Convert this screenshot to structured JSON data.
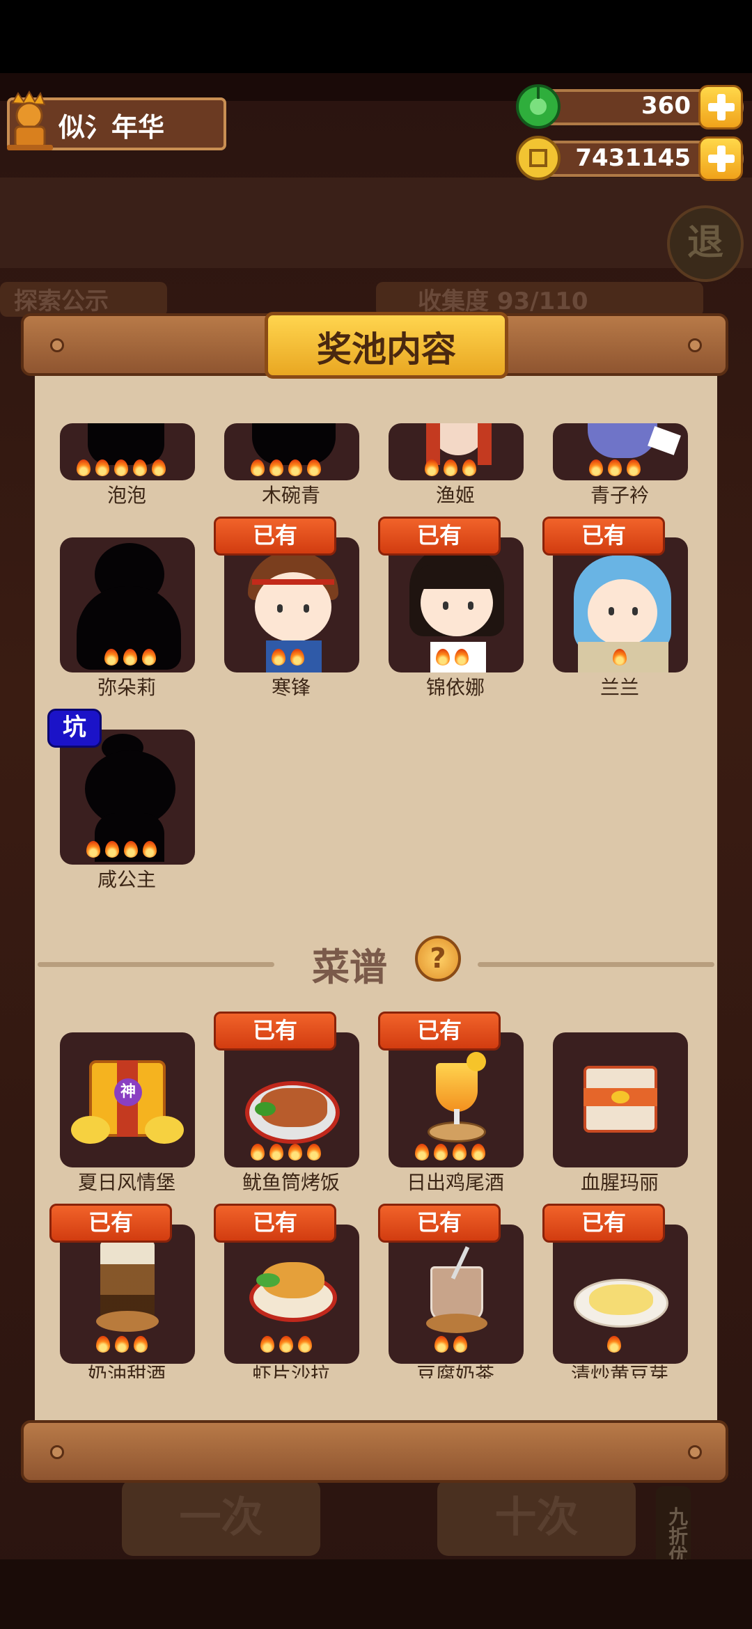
{
  "player": {
    "name": "似氵年华"
  },
  "resources": {
    "jade": "360",
    "coins": "7431145"
  },
  "background": {
    "left_tab": "探索公示",
    "right_tab": "收集度 93/110",
    "exit": "退",
    "one_draw": "一次",
    "ten_draw": "十次",
    "discount": "九折优惠"
  },
  "dialog": {
    "title": "奖池内容"
  },
  "characters": [
    {
      "name": "泡泡",
      "stars": 5,
      "owned": false
    },
    {
      "name": "木碗青",
      "stars": 4,
      "owned": false
    },
    {
      "name": "渔姬",
      "stars": 3,
      "owned": false
    },
    {
      "name": "青子衿",
      "stars": 3,
      "owned": false
    },
    {
      "name": "弥朵莉",
      "stars": 3,
      "owned": false
    },
    {
      "name": "寒锋",
      "stars": 2,
      "owned": true
    },
    {
      "name": "锦依娜",
      "stars": 2,
      "owned": true
    },
    {
      "name": "兰兰",
      "stars": 1,
      "owned": true
    },
    {
      "name": "咸公主",
      "stars": 4,
      "owned": false,
      "badge": "坑"
    }
  ],
  "recipes_section": {
    "title": "菜谱",
    "help": "?"
  },
  "recipes": [
    {
      "name": "夏日风情堡",
      "stars": 0,
      "owned": false,
      "badge": "神"
    },
    {
      "name": "鱿鱼筒烤饭",
      "stars": 4,
      "owned": true
    },
    {
      "name": "日出鸡尾酒",
      "stars": 4,
      "owned": true
    },
    {
      "name": "血腥玛丽",
      "stars": 0,
      "owned": false
    },
    {
      "name": "奶油甜酒",
      "stars": 3,
      "owned": true
    },
    {
      "name": "虾片沙拉",
      "stars": 3,
      "owned": true
    },
    {
      "name": "豆腐奶茶",
      "stars": 2,
      "owned": true
    },
    {
      "name": "清炒黄豆芽",
      "stars": 1,
      "owned": true
    }
  ],
  "labels": {
    "owned": "已有"
  }
}
